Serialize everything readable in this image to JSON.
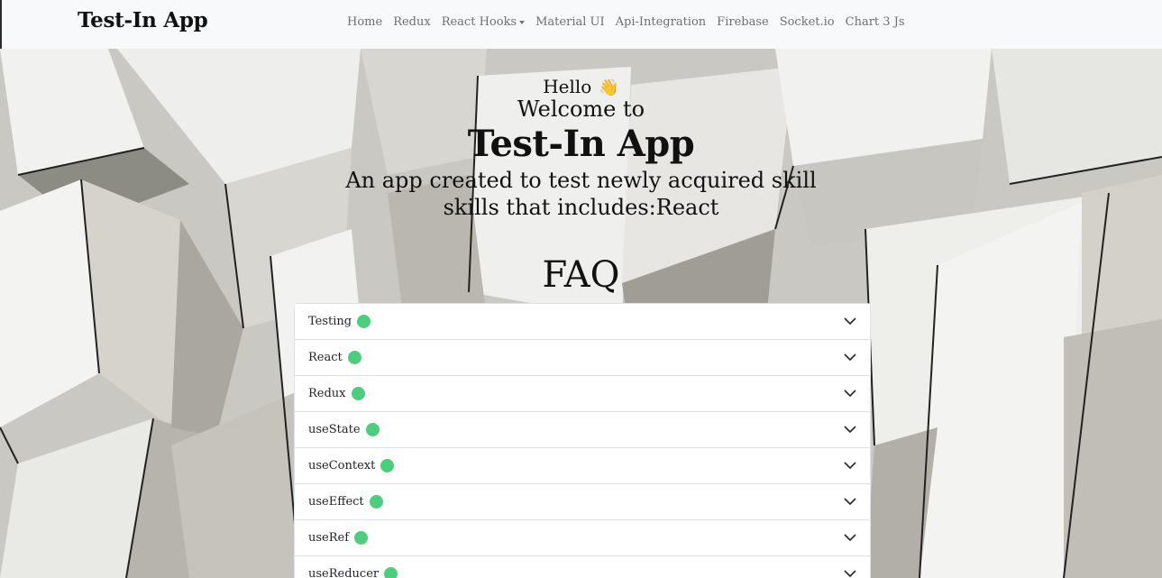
{
  "navbar": {
    "brand": "Test-In App",
    "links": [
      {
        "label": "Home"
      },
      {
        "label": "Redux"
      },
      {
        "label": "React Hooks",
        "dropdown": true
      },
      {
        "label": "Material UI"
      },
      {
        "label": "Api-Integration"
      },
      {
        "label": "Firebase"
      },
      {
        "label": "Socket.io"
      },
      {
        "label": "Chart 3 Js"
      }
    ]
  },
  "hero": {
    "hello": "Hello",
    "wave_icon": "👋",
    "welcome": "Welcome to",
    "title": "Test-In App",
    "tagline_line1": "An app created to test newly acquired skill",
    "tagline_line2": "skills that includes:React"
  },
  "faq": {
    "title": "FAQ",
    "status_color": "#4bcf7c",
    "items": [
      {
        "label": "Testing"
      },
      {
        "label": "React"
      },
      {
        "label": "Redux"
      },
      {
        "label": "useState"
      },
      {
        "label": "useContext"
      },
      {
        "label": "useEffect"
      },
      {
        "label": "useRef"
      },
      {
        "label": "useReducer"
      }
    ]
  }
}
